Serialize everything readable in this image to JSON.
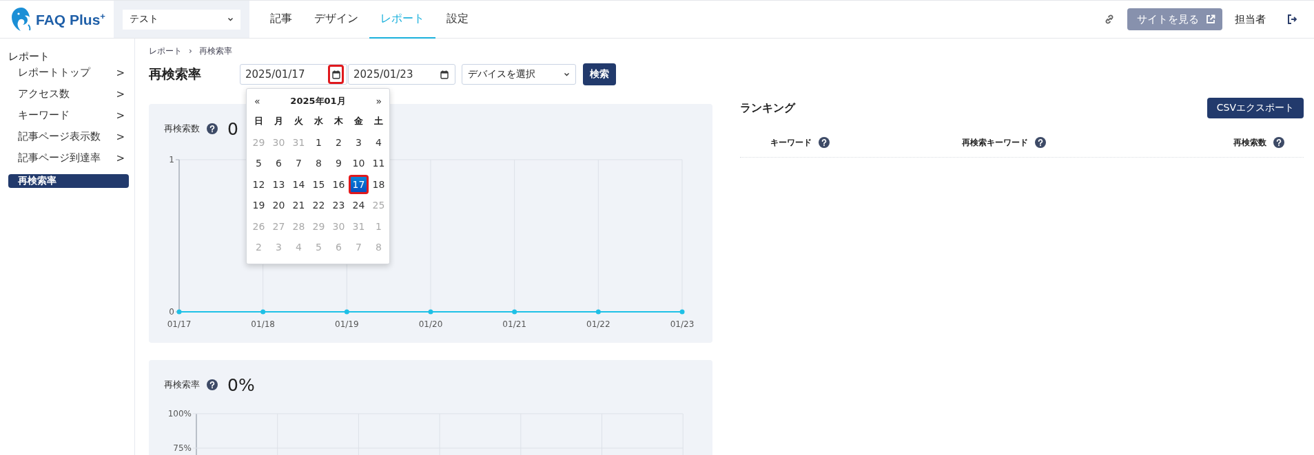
{
  "header": {
    "logo": {
      "text": "FAQ Plus$^{+}$"
    },
    "site_select": {
      "value": "テスト"
    },
    "nav": [
      {
        "label": "記事",
        "selected": false
      },
      {
        "label": "デザイン",
        "selected": false
      },
      {
        "label": "レポート",
        "selected": true
      },
      {
        "label": "設定",
        "selected": false
      }
    ],
    "view_site_button": "サイトを見る",
    "user": "担当者"
  },
  "sidebar": {
    "heading": "レポート",
    "items": [
      {
        "label": "レポートトップ",
        "chevron": ">",
        "selected": false
      },
      {
        "label": "アクセス数",
        "chevron": ">",
        "selected": false
      },
      {
        "label": "キーワード",
        "chevron": ">",
        "selected": false
      },
      {
        "label": "記事ページ表示数",
        "chevron": ">",
        "selected": false
      },
      {
        "label": "記事ページ到達率",
        "chevron": ">",
        "selected": false
      },
      {
        "label": "再検索率",
        "selected": true
      }
    ]
  },
  "breadcrumb": {
    "items": [
      "レポート",
      "再検索率"
    ],
    "separator": "›"
  },
  "page_title": "再検索率",
  "filters": {
    "start_date": {
      "value": "2025/01/17",
      "highlighted": true
    },
    "end_date": {
      "value": "2025/01/23",
      "highlighted": false
    },
    "device_select": {
      "placeholder": "デバイスを選択"
    },
    "search_button": "検索"
  },
  "calendar": {
    "prev": "«",
    "title": "2025年01月",
    "next": "»",
    "weekdays": [
      "日",
      "月",
      "火",
      "水",
      "木",
      "金",
      "土"
    ],
    "weeks": [
      [
        {
          "day": "29",
          "outside": true,
          "selected": false
        },
        {
          "day": "30",
          "outside": true,
          "selected": false
        },
        {
          "day": "31",
          "outside": true,
          "selected": false
        },
        {
          "day": "1",
          "outside": false,
          "selected": false
        },
        {
          "day": "2",
          "outside": false,
          "selected": false
        },
        {
          "day": "3",
          "outside": false,
          "selected": false
        },
        {
          "day": "4",
          "outside": false,
          "selected": false
        }
      ],
      [
        {
          "day": "5",
          "outside": false,
          "selected": false
        },
        {
          "day": "6",
          "outside": false,
          "selected": false
        },
        {
          "day": "7",
          "outside": false,
          "selected": false
        },
        {
          "day": "8",
          "outside": false,
          "selected": false
        },
        {
          "day": "9",
          "outside": false,
          "selected": false
        },
        {
          "day": "10",
          "outside": false,
          "selected": false
        },
        {
          "day": "11",
          "outside": false,
          "selected": false
        }
      ],
      [
        {
          "day": "12",
          "outside": false,
          "selected": false
        },
        {
          "day": "13",
          "outside": false,
          "selected": false
        },
        {
          "day": "14",
          "outside": false,
          "selected": false
        },
        {
          "day": "15",
          "outside": false,
          "selected": false
        },
        {
          "day": "16",
          "outside": false,
          "selected": false
        },
        {
          "day": "17",
          "outside": false,
          "selected": true,
          "highlighted": true
        },
        {
          "day": "18",
          "outside": false,
          "selected": false
        }
      ],
      [
        {
          "day": "19",
          "outside": false,
          "selected": false
        },
        {
          "day": "20",
          "outside": false,
          "selected": false
        },
        {
          "day": "21",
          "outside": false,
          "selected": false
        },
        {
          "day": "22",
          "outside": false,
          "selected": false
        },
        {
          "day": "23",
          "outside": false,
          "selected": false
        },
        {
          "day": "24",
          "outside": false,
          "selected": false
        },
        {
          "day": "25",
          "outside": true,
          "selected": false
        }
      ],
      [
        {
          "day": "26",
          "outside": true,
          "selected": false
        },
        {
          "day": "27",
          "outside": true,
          "selected": false
        },
        {
          "day": "28",
          "outside": true,
          "selected": false
        },
        {
          "day": "29",
          "outside": true,
          "selected": false
        },
        {
          "day": "30",
          "outside": true,
          "selected": false
        },
        {
          "day": "31",
          "outside": true,
          "selected": false
        },
        {
          "day": "1",
          "outside": true,
          "selected": false
        }
      ],
      [
        {
          "day": "2",
          "outside": true,
          "selected": false
        },
        {
          "day": "3",
          "outside": true,
          "selected": false
        },
        {
          "day": "4",
          "outside": true,
          "selected": false
        },
        {
          "day": "5",
          "outside": true,
          "selected": false
        },
        {
          "day": "6",
          "outside": true,
          "selected": false
        },
        {
          "day": "7",
          "outside": true,
          "selected": false
        },
        {
          "day": "8",
          "outside": true,
          "selected": false
        }
      ]
    ]
  },
  "charts": [
    {
      "label": "再検索数",
      "value": "0",
      "chart_data": {
        "type": "line",
        "categories": [
          "01/17",
          "01/18",
          "01/19",
          "01/20",
          "01/21",
          "01/22",
          "01/23"
        ],
        "series": [
          {
            "color": "#1ec0e6",
            "marker": true,
            "values": [
              0,
              0,
              0,
              0,
              0,
              0,
              0
            ]
          }
        ],
        "ylim": [
          0,
          1
        ],
        "yticks": [
          0,
          1
        ],
        "grid": true
      }
    },
    {
      "label": "再検索率",
      "value": "0%",
      "axis_labels": [
        "100%",
        "75%"
      ]
    }
  ],
  "ranking": {
    "title": "ランキング",
    "export_button": "CSVエクスポート",
    "columns": [
      "キーワード",
      "再検索キーワード",
      "再検索数"
    ]
  }
}
